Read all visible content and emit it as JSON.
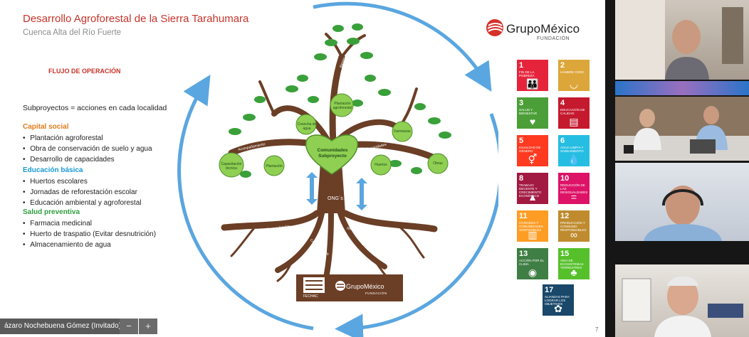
{
  "slide": {
    "title": "Desarrollo Agroforestal de la Sierra Tarahumara",
    "subtitle": "Cuenca Alta del Río Fuerte",
    "flow_title": "FLUJO DE OPERACIÓN",
    "intro": "Subproyectos = acciones en cada localidad",
    "sections": [
      {
        "title": "Capital social",
        "color": "#e07b1a",
        "items": [
          "Plantación agroforestal",
          "Obra de conservación de suelo y agua",
          "Desarrollo de capacidades"
        ]
      },
      {
        "title": "Educación básica",
        "color": "#1a9ad6",
        "items": [
          "Huertos escolares",
          "Jornadas de reforestación escolar",
          "Educación ambiental y agroforestal"
        ]
      },
      {
        "title": "Salud preventiva",
        "color": "#2e9e3e",
        "items": [
          "Farmacia medicinal",
          "Huerto de traspatio (Evitar desnutrición)",
          "Almacenamiento de agua"
        ]
      }
    ],
    "logo": {
      "name": "GrupoMéxico",
      "sub": "FUNDACIÓN"
    },
    "tree": {
      "heart": [
        "Comunidades",
        "Subproyecto"
      ],
      "trunk_label": "ONG´s",
      "fruits": [
        "Capacitación técnica",
        "Plantación",
        "Cosecha de agua",
        "Plantación agroforestal",
        "Farmacias",
        "Huertos",
        "Obras"
      ],
      "branches": [
        "Acompañamiento",
        "Capacidades",
        "Bienes",
        "Saberes"
      ],
      "roots": [
        "Alianzas locales",
        "Recursos económicos",
        "Conocimientos"
      ],
      "footer_logos": [
        "FECHAC",
        "GrupoMéxico",
        "FUNDACIÓN"
      ]
    },
    "sdgs": [
      {
        "num": "1",
        "label": "Fin de la pobreza",
        "color": "#e5243b",
        "icon": "people-icon",
        "glyph": "👪"
      },
      {
        "num": "2",
        "label": "Hambre cero",
        "color": "#dda63a",
        "icon": "bowl-icon",
        "glyph": "◡"
      },
      {
        "num": "3",
        "label": "Salud y bienestar",
        "color": "#4c9f38",
        "icon": "heartbeat-icon",
        "glyph": "♥"
      },
      {
        "num": "4",
        "label": "Educación de calidad",
        "color": "#c5192d",
        "icon": "book-icon",
        "glyph": "▤"
      },
      {
        "num": "5",
        "label": "Igualdad de género",
        "color": "#ff3a21",
        "icon": "gender-icon",
        "glyph": "⚥"
      },
      {
        "num": "6",
        "label": "Agua limpia y saneamiento",
        "color": "#26bde2",
        "icon": "water-drop-icon",
        "glyph": "💧"
      },
      {
        "num": "8",
        "label": "Trabajo decente y crecimiento económico",
        "color": "#a21942",
        "icon": "growth-chart-icon",
        "glyph": "▲"
      },
      {
        "num": "10",
        "label": "Reducción de las desigualdades",
        "color": "#dd1367",
        "icon": "equality-icon",
        "glyph": "="
      },
      {
        "num": "11",
        "label": "Ciudades y comunidades sostenibles",
        "color": "#fd9d24",
        "icon": "city-icon",
        "glyph": "▥"
      },
      {
        "num": "12",
        "label": "Producción y consumo responsables",
        "color": "#bf8b2e",
        "icon": "infinity-icon",
        "glyph": "∞"
      },
      {
        "num": "13",
        "label": "Acción por el clima",
        "color": "#3f7e44",
        "icon": "eye-globe-icon",
        "glyph": "◉"
      },
      {
        "num": "15",
        "label": "Vida de ecosistemas terrestres",
        "color": "#56c02b",
        "icon": "tree-icon",
        "glyph": "♣"
      },
      {
        "num": "17",
        "label": "Alianzas para lograr los objetivos",
        "color": "#19486a",
        "icon": "flower-icon",
        "glyph": "✿"
      }
    ],
    "page_number": "7"
  },
  "meeting": {
    "participant_name": "ázaro Nochebuena Gómez (Invitado)",
    "zoom_out": "−",
    "zoom_in": "+"
  },
  "colors": {
    "arrow": "#5aa6e0",
    "trunk": "#6b3e26",
    "leaf": "#3aa03a",
    "fruit": "#8fcf52"
  }
}
